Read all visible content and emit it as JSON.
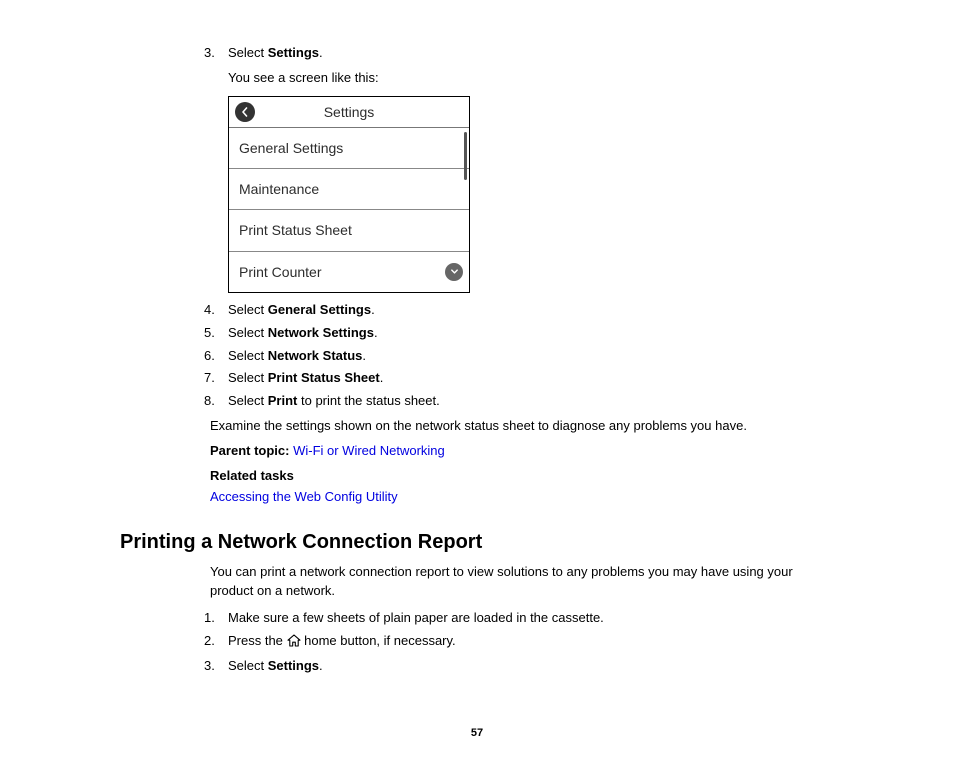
{
  "steps_a": {
    "s3_num": "3.",
    "s3_pre": "Select ",
    "s3_bold": "Settings",
    "s3_post": ".",
    "s3_sub": "You see a screen like this:",
    "s4_num": "4.",
    "s4_pre": "Select ",
    "s4_bold": "General Settings",
    "s4_post": ".",
    "s5_num": "5.",
    "s5_pre": "Select ",
    "s5_bold": "Network Settings",
    "s5_post": ".",
    "s6_num": "6.",
    "s6_pre": "Select ",
    "s6_bold": "Network Status",
    "s6_post": ".",
    "s7_num": "7.",
    "s7_pre": "Select ",
    "s7_bold": "Print Status Sheet",
    "s7_post": ".",
    "s8_num": "8.",
    "s8_pre": "Select ",
    "s8_bold": "Print",
    "s8_post": " to print the status sheet."
  },
  "screenshot": {
    "title": "Settings",
    "row1": "General Settings",
    "row2": "Maintenance",
    "row3": "Print Status Sheet",
    "row4": "Print Counter"
  },
  "examine_line": "Examine the settings shown on the network status sheet to diagnose any problems you have.",
  "parent_label": "Parent topic: ",
  "parent_link": "Wi-Fi or Wired Networking",
  "related_label": "Related tasks",
  "related_link": "Accessing the Web Config Utility",
  "section_heading": "Printing a Network Connection Report",
  "section_intro": "You can print a network connection report to view solutions to any problems you may have using your product on a network.",
  "steps_b": {
    "s1_num": "1.",
    "s1_text": "Make sure a few sheets of plain paper are loaded in the cassette.",
    "s2_num": "2.",
    "s2_pre": "Press the ",
    "s2_post": " home button, if necessary.",
    "s3_num": "3.",
    "s3_pre": "Select ",
    "s3_bold": "Settings",
    "s3_post": "."
  },
  "page_number": "57"
}
